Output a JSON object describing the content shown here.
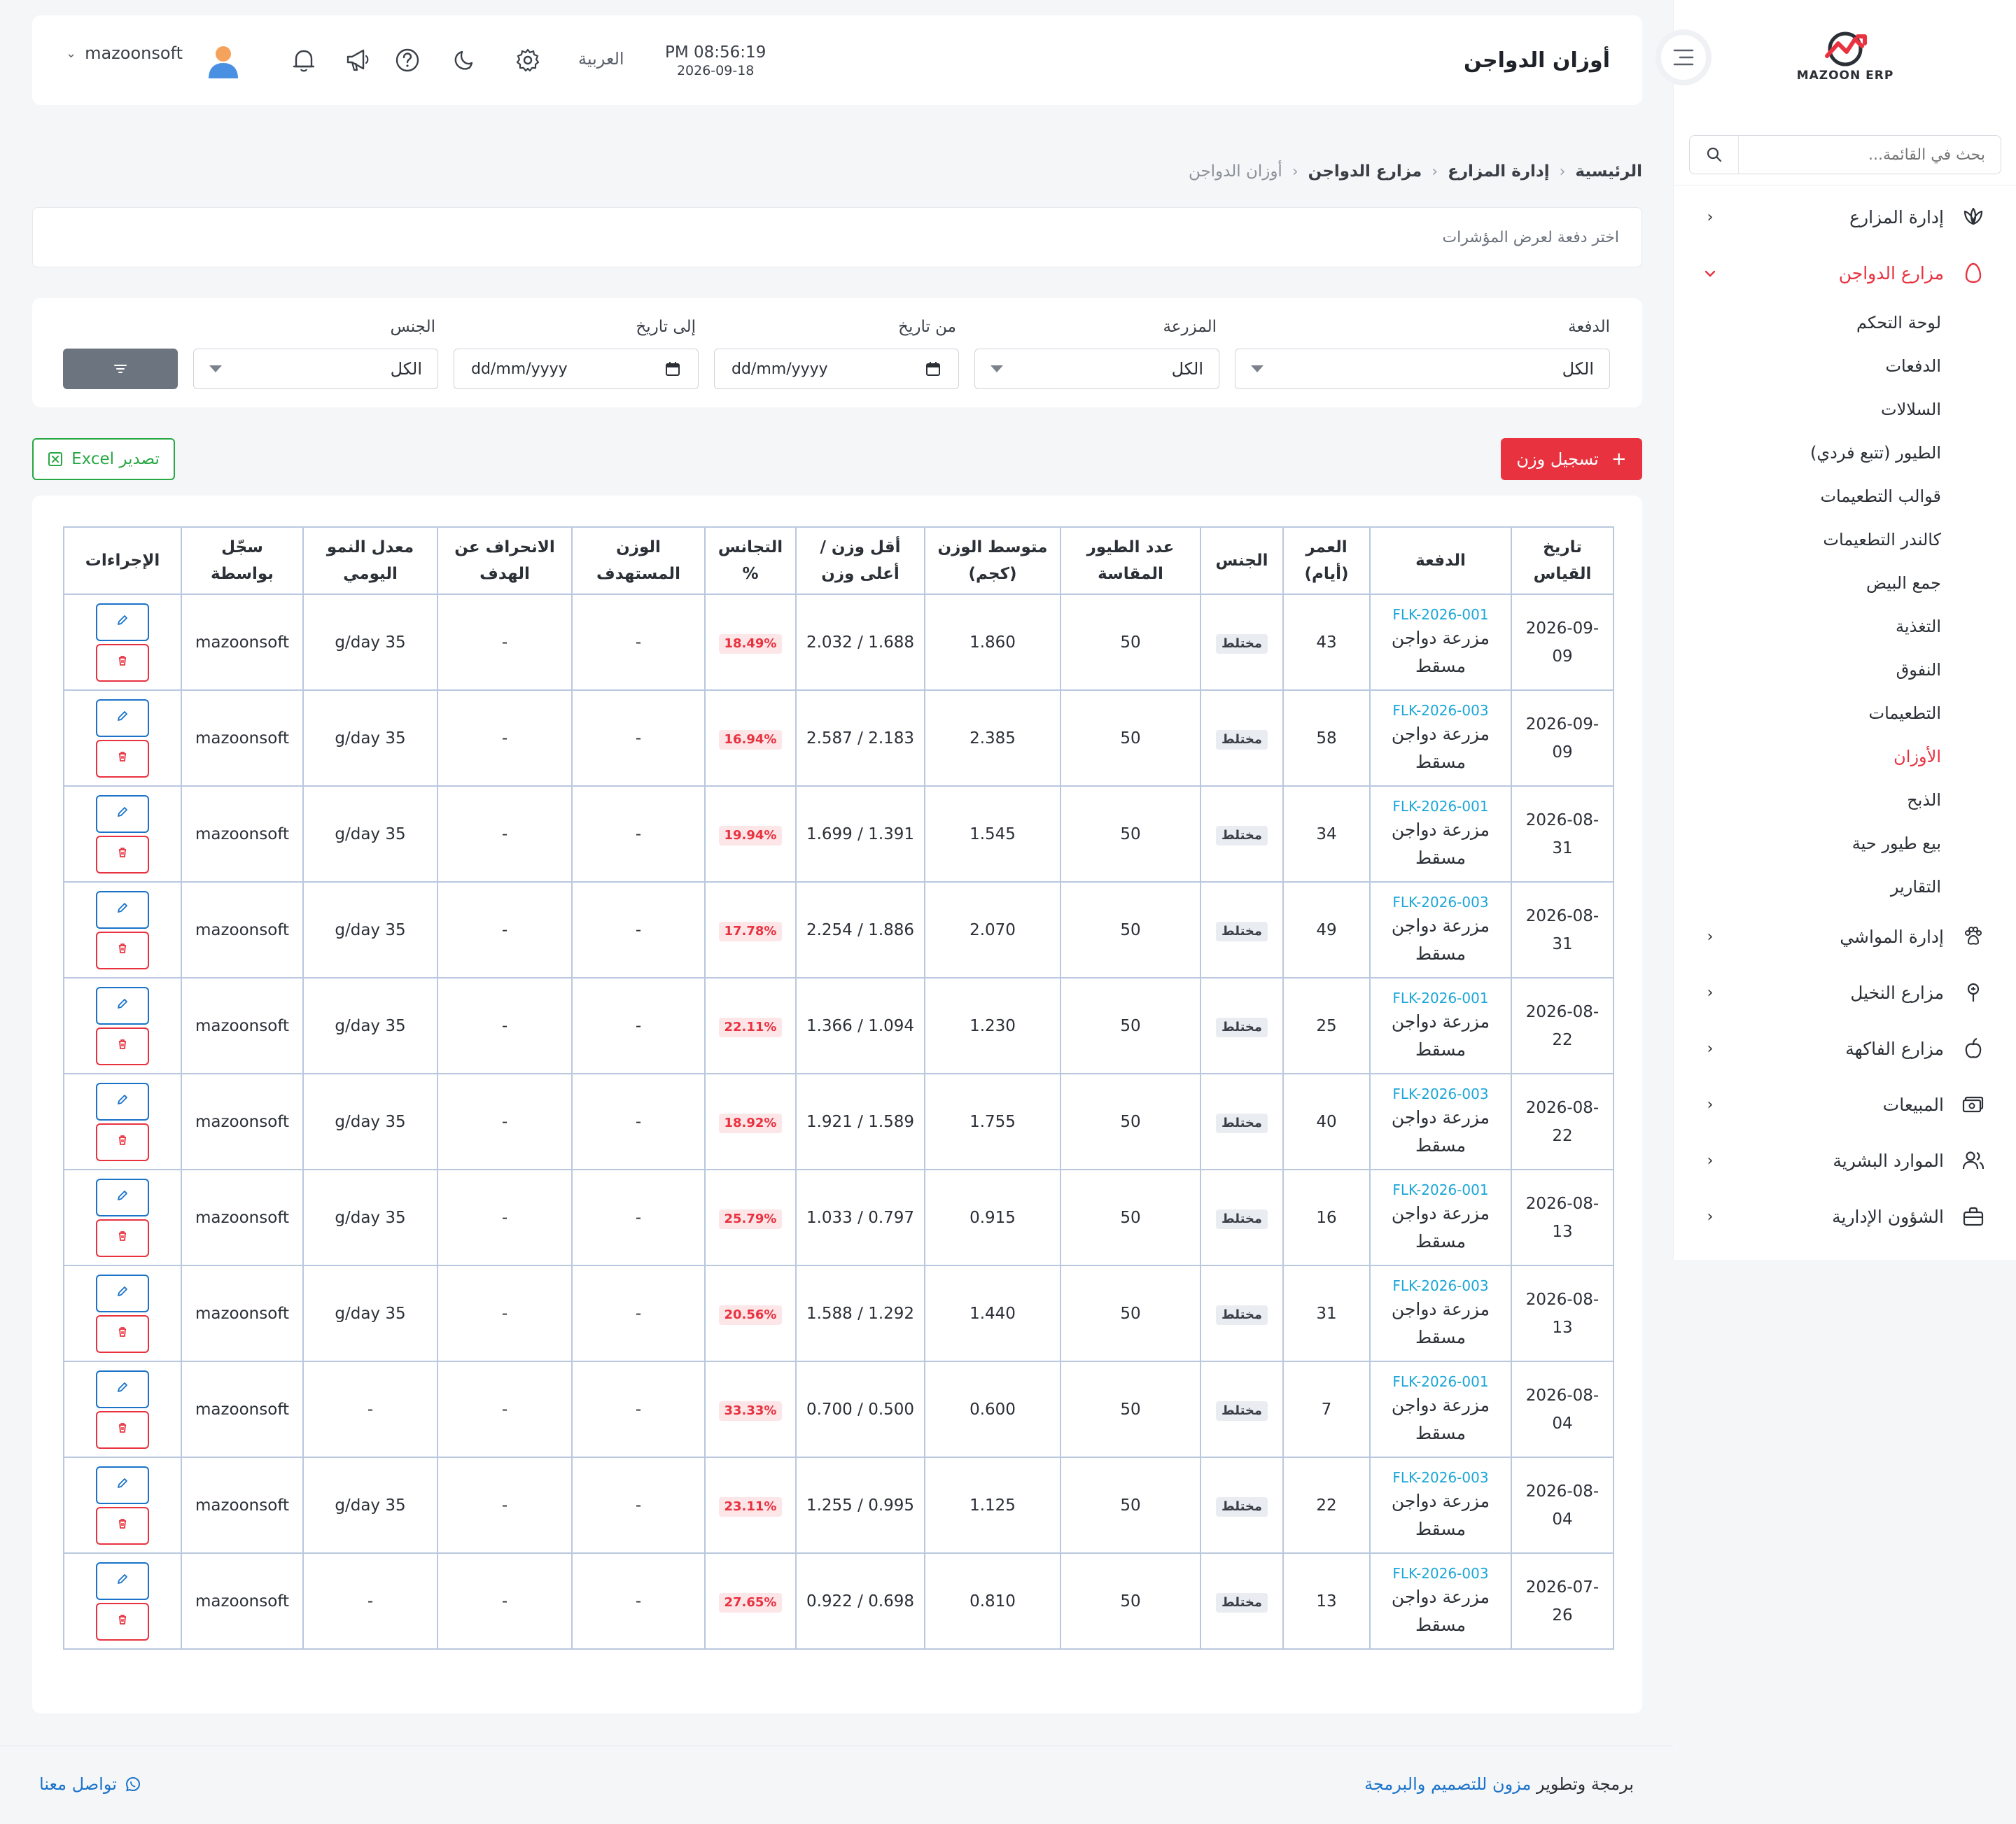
{
  "app": {
    "logo_text": "MAZOON ERP"
  },
  "sidebar": {
    "search_placeholder": "بحث في القائمة...",
    "items": [
      {
        "label": "إدارة المزارع",
        "icon": "plant-icon",
        "expanded": false
      },
      {
        "label": "مزارع الدواجن",
        "icon": "egg-icon",
        "expanded": true,
        "children": [
          "لوحة التحكم",
          "الدفعات",
          "السلالات",
          "الطيور (تتبع فردي)",
          "قوالب التطعيمات",
          "كالندر التطعيمات",
          "جمع البيض",
          "التغذية",
          "النفوق",
          "التطعيمات",
          "الأوزان",
          "الذبح",
          "بيع طيور حية",
          "التقارير"
        ],
        "active_child": "الأوزان"
      },
      {
        "label": "إدارة المواشي",
        "icon": "paw-icon",
        "expanded": false
      },
      {
        "label": "مزارع النخيل",
        "icon": "palm-icon",
        "expanded": false
      },
      {
        "label": "مزارع الفاكهة",
        "icon": "fruit-icon",
        "expanded": false
      },
      {
        "label": "المبيعات",
        "icon": "cash-icon",
        "expanded": false
      },
      {
        "label": "الموارد البشرية",
        "icon": "users-icon",
        "expanded": false
      },
      {
        "label": "الشؤون الإدارية",
        "icon": "briefcase-icon",
        "expanded": false
      }
    ]
  },
  "header": {
    "title": "أوزان الدواجن",
    "time": "PM 08:56:19",
    "date": "2026-09-18",
    "language": "العربية",
    "username": "mazoonsoft"
  },
  "breadcrumb": [
    "الرئيسية",
    "إدارة المزارع",
    "مزارع الدواجن",
    "أوزان الدواجن"
  ],
  "info_text": "اختر دفعة لعرض المؤشرات",
  "filters": {
    "batch": {
      "label": "الدفعة",
      "value": "الكل"
    },
    "farm": {
      "label": "المزرعة",
      "value": "الكل"
    },
    "from_date": {
      "label": "من تاريخ",
      "placeholder": "dd/mm/yyyy"
    },
    "to_date": {
      "label": "إلى تاريخ",
      "placeholder": "dd/mm/yyyy"
    },
    "sex": {
      "label": "الجنس",
      "value": "الكل"
    }
  },
  "actions": {
    "add_label": "تسجيل وزن",
    "add_icon": "+",
    "export_label": "تصدير Excel"
  },
  "table": {
    "headers": [
      "تاريخ القياس",
      "الدفعة",
      "العمر (أيام)",
      "الجنس",
      "عدد الطيور المقاسة",
      "متوسط الوزن (كجم)",
      "أقل وزن / أعلى وزن",
      "التجانس %",
      "الوزن المستهدف",
      "الانحراف عن الهدف",
      "معدل النمو اليومي",
      "سجّل بواسطة",
      "الإجراءات"
    ],
    "rows": [
      {
        "date": "2026-09-09",
        "code": "FLK-2026-001",
        "farm": "مزرعة دواجن مسقط",
        "age": "43",
        "sex": "مختلط",
        "count": "50",
        "avg": "1.860",
        "minmax": "1.688 / 2.032",
        "uniformity": "18.49%",
        "target": "-",
        "deviation": "-",
        "growth": "35 g/day",
        "by": "mazoonsoft"
      },
      {
        "date": "2026-09-09",
        "code": "FLK-2026-003",
        "farm": "مزرعة دواجن مسقط",
        "age": "58",
        "sex": "مختلط",
        "count": "50",
        "avg": "2.385",
        "minmax": "2.183 / 2.587",
        "uniformity": "16.94%",
        "target": "-",
        "deviation": "-",
        "growth": "35 g/day",
        "by": "mazoonsoft"
      },
      {
        "date": "2026-08-31",
        "code": "FLK-2026-001",
        "farm": "مزرعة دواجن مسقط",
        "age": "34",
        "sex": "مختلط",
        "count": "50",
        "avg": "1.545",
        "minmax": "1.391 / 1.699",
        "uniformity": "19.94%",
        "target": "-",
        "deviation": "-",
        "growth": "35 g/day",
        "by": "mazoonsoft"
      },
      {
        "date": "2026-08-31",
        "code": "FLK-2026-003",
        "farm": "مزرعة دواجن مسقط",
        "age": "49",
        "sex": "مختلط",
        "count": "50",
        "avg": "2.070",
        "minmax": "1.886 / 2.254",
        "uniformity": "17.78%",
        "target": "-",
        "deviation": "-",
        "growth": "35 g/day",
        "by": "mazoonsoft"
      },
      {
        "date": "2026-08-22",
        "code": "FLK-2026-001",
        "farm": "مزرعة دواجن مسقط",
        "age": "25",
        "sex": "مختلط",
        "count": "50",
        "avg": "1.230",
        "minmax": "1.094 / 1.366",
        "uniformity": "22.11%",
        "target": "-",
        "deviation": "-",
        "growth": "35 g/day",
        "by": "mazoonsoft"
      },
      {
        "date": "2026-08-22",
        "code": "FLK-2026-003",
        "farm": "مزرعة دواجن مسقط",
        "age": "40",
        "sex": "مختلط",
        "count": "50",
        "avg": "1.755",
        "minmax": "1.589 / 1.921",
        "uniformity": "18.92%",
        "target": "-",
        "deviation": "-",
        "growth": "35 g/day",
        "by": "mazoonsoft"
      },
      {
        "date": "2026-08-13",
        "code": "FLK-2026-001",
        "farm": "مزرعة دواجن مسقط",
        "age": "16",
        "sex": "مختلط",
        "count": "50",
        "avg": "0.915",
        "minmax": "0.797 / 1.033",
        "uniformity": "25.79%",
        "target": "-",
        "deviation": "-",
        "growth": "35 g/day",
        "by": "mazoonsoft"
      },
      {
        "date": "2026-08-13",
        "code": "FLK-2026-003",
        "farm": "مزرعة دواجن مسقط",
        "age": "31",
        "sex": "مختلط",
        "count": "50",
        "avg": "1.440",
        "minmax": "1.292 / 1.588",
        "uniformity": "20.56%",
        "target": "-",
        "deviation": "-",
        "growth": "35 g/day",
        "by": "mazoonsoft"
      },
      {
        "date": "2026-08-04",
        "code": "FLK-2026-001",
        "farm": "مزرعة دواجن مسقط",
        "age": "7",
        "sex": "مختلط",
        "count": "50",
        "avg": "0.600",
        "minmax": "0.500 / 0.700",
        "uniformity": "33.33%",
        "target": "-",
        "deviation": "-",
        "growth": "-",
        "by": "mazoonsoft"
      },
      {
        "date": "2026-08-04",
        "code": "FLK-2026-003",
        "farm": "مزرعة دواجن مسقط",
        "age": "22",
        "sex": "مختلط",
        "count": "50",
        "avg": "1.125",
        "minmax": "0.995 / 1.255",
        "uniformity": "23.11%",
        "target": "-",
        "deviation": "-",
        "growth": "35 g/day",
        "by": "mazoonsoft"
      },
      {
        "date": "2026-07-26",
        "code": "FLK-2026-003",
        "farm": "مزرعة دواجن مسقط",
        "age": "13",
        "sex": "مختلط",
        "count": "50",
        "avg": "0.810",
        "minmax": "0.698 / 0.922",
        "uniformity": "27.65%",
        "target": "-",
        "deviation": "-",
        "growth": "-",
        "by": "mazoonsoft"
      }
    ]
  },
  "footer": {
    "credits_prefix": "برمجة وتطوير",
    "credits_link": "مزون للتصميم والبرمجة",
    "contact": "تواصل معنا"
  },
  "colors": {
    "accent": "#e8323f",
    "link": "#1a73c9",
    "code": "#1aa6d7",
    "export": "#28a745",
    "filter_button": "#6c757f"
  }
}
